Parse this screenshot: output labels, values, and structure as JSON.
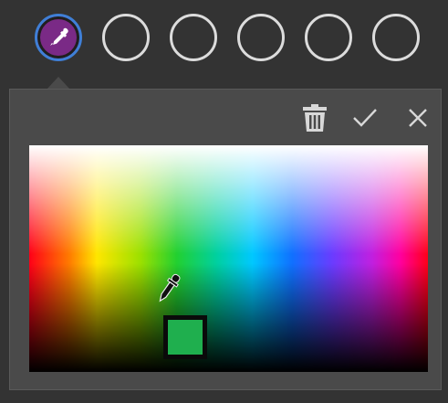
{
  "swatches": [
    {
      "name": "swatch-1",
      "state": "active",
      "fill": "#7a2a86",
      "icon": "eyedropper-icon"
    },
    {
      "name": "swatch-2",
      "state": "empty"
    },
    {
      "name": "swatch-3",
      "state": "empty"
    },
    {
      "name": "swatch-4",
      "state": "empty"
    },
    {
      "name": "swatch-5",
      "state": "empty"
    },
    {
      "name": "swatch-6",
      "state": "empty"
    }
  ],
  "toolbar": {
    "delete_icon": "trash-icon",
    "confirm_icon": "checkmark-icon",
    "close_icon": "close-icon"
  },
  "picker": {
    "cursor_icon": "eyedropper-icon",
    "selected_color": "#1faf4e"
  },
  "colors": {
    "background": "#333333",
    "panel": "#4a4a4a",
    "accent": "#3f7fd6",
    "icon": "#d8d8d8"
  }
}
